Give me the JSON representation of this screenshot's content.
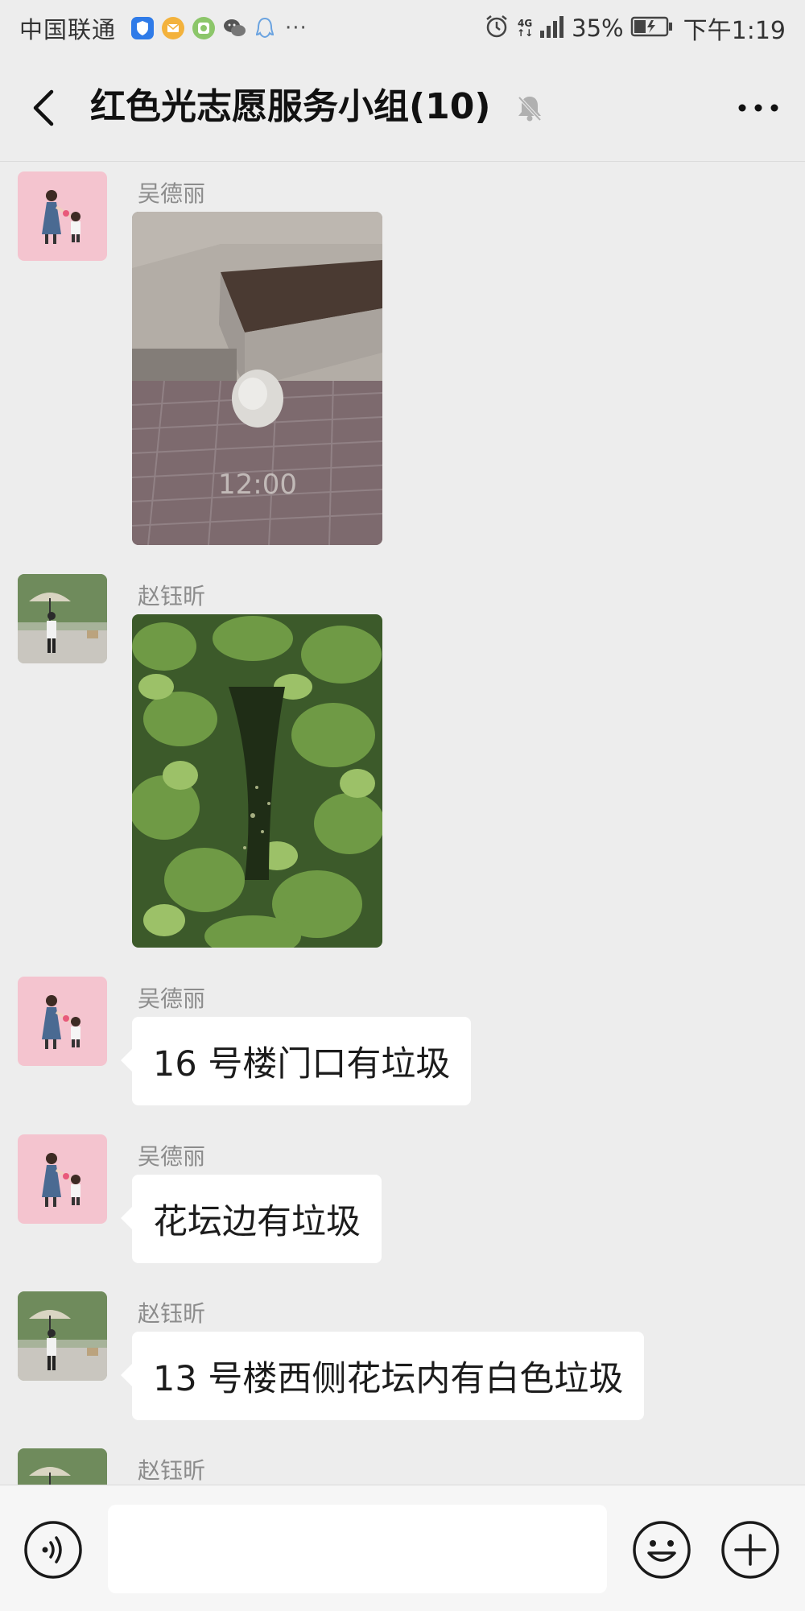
{
  "status_bar": {
    "carrier": "中国联通",
    "more_indicator": "···",
    "notification_icons": [
      "shield-icon",
      "mail-icon",
      "message-app-icon",
      "wechat-icon",
      "qq-icon"
    ],
    "network_label_top": "4G",
    "network_label_bottom": "↑↓",
    "battery_percent": "35%",
    "time": "下午1:19",
    "charging": true
  },
  "header": {
    "title": "红色光志愿服务小组(10)",
    "muted": true,
    "back_icon": "chevron-left-icon",
    "more_icon": "more-dots-icon"
  },
  "messages": [
    {
      "sender": "吴德丽",
      "type": "image",
      "image_desc": "paving-with-trash-bag",
      "photo_overlay_time": "12:00"
    },
    {
      "sender": "赵钰昕",
      "type": "image",
      "image_desc": "green-shrubs"
    },
    {
      "sender": "吴德丽",
      "type": "text",
      "text": "16 号楼门口有垃圾"
    },
    {
      "sender": "吴德丽",
      "type": "text",
      "text": "花坛边有垃圾"
    },
    {
      "sender": "赵钰昕",
      "type": "text",
      "text": "13 号楼西侧花坛内有白色垃圾"
    },
    {
      "sender": "赵钰昕",
      "type": "partial"
    }
  ],
  "input_bar": {
    "value": "",
    "placeholder": "",
    "voice_icon": "voice-icon",
    "emoji_icon": "emoji-icon",
    "plus_icon": "plus-icon"
  },
  "colors": {
    "background": "#ededed",
    "bubble": "#ffffff",
    "sender_name": "#8c8c8c",
    "input_bar": "#f6f6f6"
  }
}
